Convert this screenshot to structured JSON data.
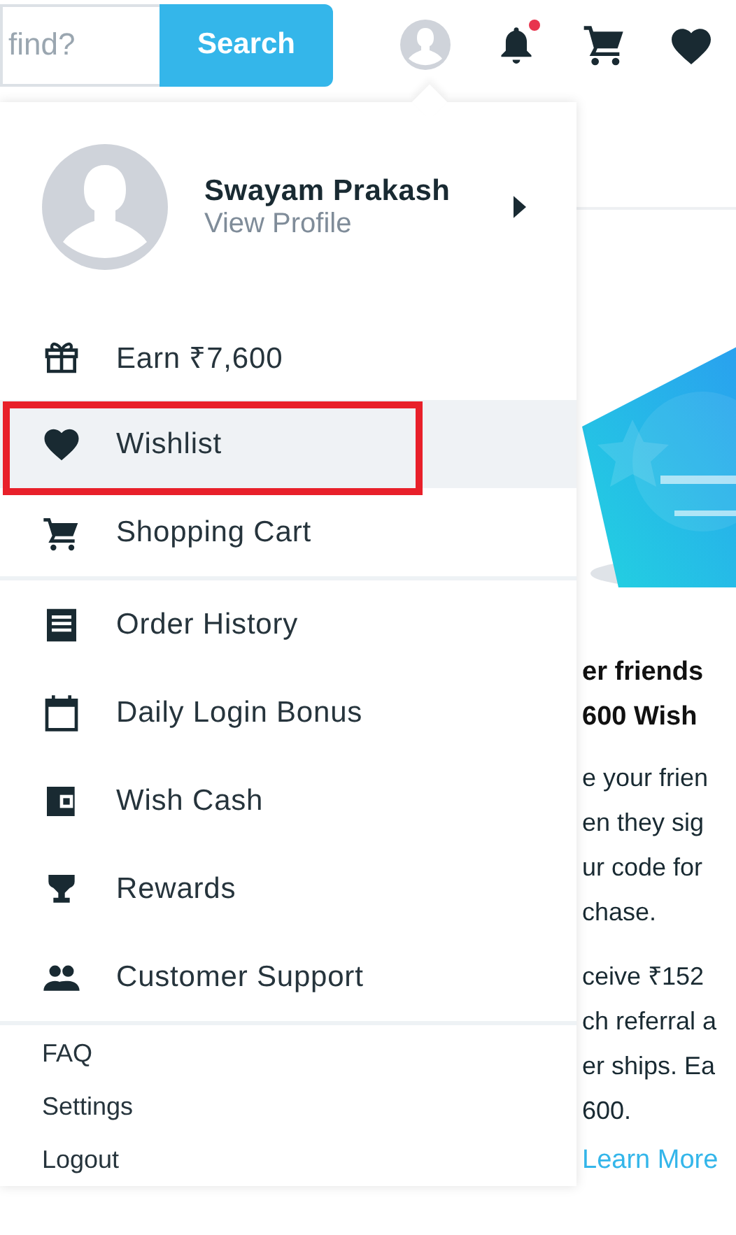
{
  "header": {
    "search": {
      "placeholder": "find?"
    },
    "search_button": "Search",
    "notifications_unread": true
  },
  "menu": {
    "profile": {
      "name": "Swayam Prakash",
      "link": "View Profile"
    },
    "sections": [
      {
        "items": [
          {
            "label": "Earn ₹7,600",
            "selected": false
          },
          {
            "label": "Wishlist",
            "selected": true
          },
          {
            "label": "Shopping Cart",
            "selected": false
          }
        ]
      },
      {
        "items": [
          {
            "label": "Order History",
            "selected": false
          },
          {
            "label": "Daily Login Bonus",
            "selected": false
          },
          {
            "label": "Wish Cash",
            "selected": false
          },
          {
            "label": "Rewards",
            "selected": false
          },
          {
            "label": "Customer Support",
            "selected": false
          }
        ]
      }
    ],
    "footer_links": [
      "FAQ",
      "Settings",
      "Logout"
    ]
  },
  "page": {
    "card": {
      "kind": "picture"
    },
    "heading_lines": [
      "er friends",
      "600 Wish"
    ],
    "paragraphs": [
      [
        "e your frien",
        "en they sig",
        "ur code for",
        "chase."
      ],
      [
        "ceive ₹152",
        "ch referral a",
        "er ships. Ea",
        "600."
      ]
    ],
    "link": "Learn More"
  }
}
